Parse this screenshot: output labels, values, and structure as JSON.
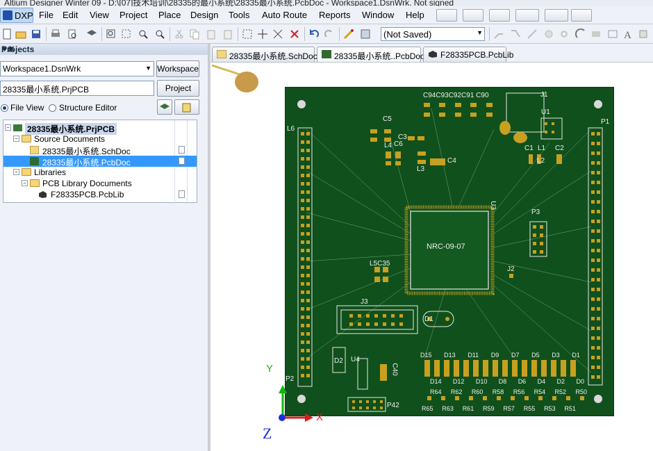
{
  "window": {
    "title": "Altium Designer Winter 09 - D:\\[07]技术培训\\28335的最小系统\\28335最小系统.PcbDoc - Workspace1.DsnWrk. Not signed"
  },
  "menu": {
    "dxp": "DXP",
    "items": [
      "File",
      "Edit",
      "View",
      "Project",
      "Place",
      "Design",
      "Tools",
      "Auto Route",
      "Reports",
      "Window",
      "Help"
    ]
  },
  "toolbar": {
    "variant_combo": "(Not Saved)"
  },
  "panel": {
    "title": "Projects",
    "workspace_field": "Workspace1.DsnWrk",
    "workspace_button": "Workspace",
    "project_field": "28335最小系统.PrjPCB",
    "project_button": "Project",
    "file_view": "File View",
    "structure_editor": "Structure Editor",
    "tree": {
      "project": "28335最小系统.PrjPCB",
      "source_documents": "Source Documents",
      "schdoc": "28335最小系统.SchDoc",
      "pcbdoc": "28335最小系统.PcbDoc",
      "libraries": "Libraries",
      "pcb_library_documents": "PCB Library Documents",
      "pcblib": "F28335PCB.PcbLib"
    }
  },
  "tabs": [
    "28335最小系统.SchDoc",
    "28335最小系统..PcbDoc",
    "F28335PCB.PcbLib"
  ],
  "pcb": {
    "chip_label": "NRC-09-07",
    "chip_ref": "U3",
    "labels": {
      "top_caps": "C94C93C92C91 C90",
      "j1": "J1",
      "u1": "U1",
      "p1": "P1",
      "p2": "P2",
      "p3": "P3",
      "j2": "J2",
      "j3": "J3",
      "l6": "L6",
      "u4": "U4",
      "d1": "D1",
      "d2": "D2",
      "c5": "C5",
      "c3": "C3",
      "c6": "C6",
      "c4": "C4",
      "l4": "L4",
      "l3": "L3",
      "c1": "C1",
      "l1": "L1",
      "c2": "C2",
      "l2": "L2",
      "l5c35": "L5C35",
      "c40": "C40",
      "p42": "P42",
      "led_top": [
        "D15",
        "D13",
        "D11",
        "D9",
        "D7",
        "D5",
        "D3",
        "D1"
      ],
      "led_bottom": [
        "D14",
        "D12",
        "D10",
        "D8",
        "D6",
        "D4",
        "D2",
        "D0"
      ],
      "res_top": [
        "R64",
        "R62",
        "R60",
        "R58",
        "R56",
        "R54",
        "R52",
        "R50"
      ],
      "res_bottom": [
        "R65",
        "R63",
        "R61",
        "R59",
        "R57",
        "R55",
        "R53",
        "R51"
      ]
    },
    "axes": {
      "x": "X",
      "y": "Y",
      "z": "Z"
    }
  }
}
